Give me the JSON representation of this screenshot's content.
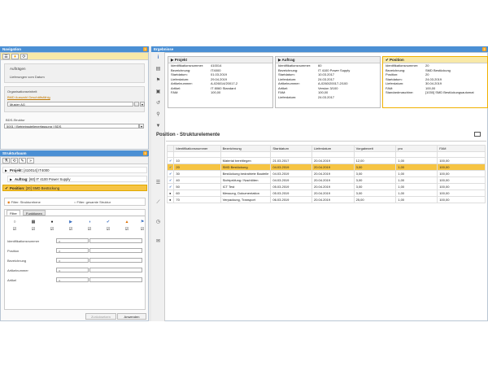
{
  "navigation": {
    "title": "Navigation",
    "help": "?",
    "favorites_header": "Aufträgen",
    "favorites_item": "Lieferungen vom Datum",
    "org_label": "Organisationseinheit",
    "org_link": "BMD Auswahl Geschäftsfähig",
    "org_value": "Muster AG",
    "bds_label": "BDS-Struktur",
    "bds_value": "5001 | Betriebsstellenerfassung | BDS"
  },
  "structure": {
    "title": "Strukturbaum",
    "help": "?",
    "tree": [
      {
        "label": "Projekt:",
        "value": "[410014] IT4000",
        "selected": false
      },
      {
        "label": "Auftrag:",
        "value": "[60] IT 4100 Power Supply",
        "selected": false
      },
      {
        "label": "Position:",
        "value": "[20] SMD Bestückung",
        "selected": true
      }
    ],
    "radio1": "Filter: Strukturebene",
    "radio2": "Filter: gesamte Struktur",
    "tabs": [
      "Filter",
      "Funktionen"
    ],
    "filter_rows": [
      {
        "label": "Identifikationsnummer",
        "op": "="
      },
      {
        "label": "Position",
        "op": "="
      },
      {
        "label": "Bezeichnung",
        "op": "="
      },
      {
        "label": "Artikelnummer",
        "op": "="
      },
      {
        "label": "Artikel",
        "op": "="
      }
    ],
    "reset_label": "Zurücksetzen",
    "apply_label": "Anwenden"
  },
  "ergebnisse": {
    "title": "Ergebnisse",
    "help": "?",
    "projekt": {
      "title": "Projekt",
      "rows": [
        {
          "k": "Identifikationsnummer:",
          "v": "410014"
        },
        {
          "k": "Bezeichnung:",
          "v": "IT4000"
        },
        {
          "k": "Startdatum:",
          "v": "01.03.2019"
        },
        {
          "k": "Lieferdatum:",
          "v": "29.04.2019"
        },
        {
          "k": "Artikelnummer:",
          "v": "A-026014/20017-2"
        },
        {
          "k": "Artikel:",
          "v": "IT 8060 Standard"
        },
        {
          "k": "FAM:",
          "v": "100,00"
        }
      ]
    },
    "auftrag": {
      "title": "Auftrag",
      "rows": [
        {
          "k": "Identifikationsnummer:",
          "v": "60"
        },
        {
          "k": "Bezeichnung:",
          "v": "IT 4100 Power Supply"
        },
        {
          "k": "Startdatum:",
          "v": "10.03.2017"
        },
        {
          "k": "Lieferdatum:",
          "v": "24.03.2017"
        },
        {
          "k": "Artikelnummer:",
          "v": "A-0260/20017-2/100"
        },
        {
          "k": "Artikel:",
          "v": "Version 3/100"
        },
        {
          "k": "FAM:",
          "v": "100,00"
        },
        {
          "k": "Lieferdatum:",
          "v": "24.03.2017"
        }
      ]
    },
    "position": {
      "title": "Position",
      "rows": [
        {
          "k": "Identifikationsnummer:",
          "v": "20"
        },
        {
          "k": "Bezeichnung:",
          "v": "SMD Bestückung"
        },
        {
          "k": "Position:",
          "v": "20"
        },
        {
          "k": "Startdatum:",
          "v": "24.03.2019"
        },
        {
          "k": "Lieferdatum:",
          "v": "30.04.2019"
        },
        {
          "k": "FAM:",
          "v": "100,00"
        },
        {
          "k": "Standardmaschine:",
          "v": "[1030] SMD Bestückungsautomat"
        }
      ]
    },
    "section_title": "Position - Strukturelemente",
    "columns": [
      "Identifikationsnummer",
      "Bezeichnung",
      "Startdatum",
      "Lieferdatum",
      "Vorgabezeit",
      "pro",
      "FAM"
    ],
    "rows": [
      {
        "status": "✔",
        "id": "10",
        "bez": "Material bereitlegen",
        "start": "21.03.2017",
        "liefer": "20.04.2019",
        "vz": "12,00",
        "pro": "1,00",
        "fam": "100,00",
        "sel": false
      },
      {
        "status": "✔",
        "id": "20",
        "bez": "SMD Bestückung",
        "start": "04.03.2019",
        "liefer": "20.04.2019",
        "vz": "3,00",
        "pro": "1,00",
        "fam": "100,00",
        "sel": true
      },
      {
        "status": "✔",
        "id": "30",
        "bez": "Bestückung bedrahtete Bauteile",
        "start": "04.03.2019",
        "liefer": "20.04.2019",
        "vz": "3,00",
        "pro": "1,00",
        "fam": "100,00",
        "sel": false
      },
      {
        "status": "✔",
        "id": "40",
        "bez": "Sichtprüfung / Nachlöten",
        "start": "04.03.2019",
        "liefer": "20.04.2019",
        "vz": "3,00",
        "pro": "1,00",
        "fam": "100,00",
        "sel": false
      },
      {
        "status": "✔",
        "id": "50",
        "bez": "ICT Test",
        "start": "05.03.2019",
        "liefer": "20.04.2019",
        "vz": "3,00",
        "pro": "1,00",
        "fam": "100,00",
        "sel": false
      },
      {
        "status": "●",
        "id": "60",
        "bez": "Messung, Dokumentation",
        "start": "05.03.2019",
        "liefer": "20.04.2019",
        "vz": "3,00",
        "pro": "1,00",
        "fam": "100,00",
        "sel": false
      },
      {
        "status": "●",
        "id": "70",
        "bez": "Verpackung, Transport",
        "start": "06.03.2019",
        "liefer": "20.04.2019",
        "vz": "25,00",
        "pro": "1,00",
        "fam": "100,00",
        "sel": false
      }
    ]
  },
  "colors": {
    "header": "#4a8fd4",
    "selected": "#f6c443",
    "accent": "#f6a623"
  }
}
